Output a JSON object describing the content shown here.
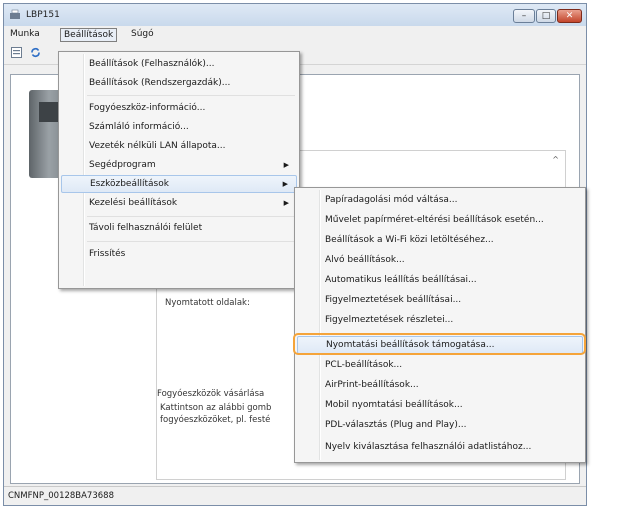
{
  "window": {
    "title": "LBP151",
    "buttons": {
      "minimize": "–",
      "maximize": "□",
      "close": "✕"
    }
  },
  "menubar": {
    "items": [
      "Munka",
      "Beállítások",
      "Súgó"
    ],
    "active": "Beállítások"
  },
  "main_menu": {
    "items": [
      {
        "label": "Beállítások (Felhasználók)..."
      },
      {
        "label": "Beállítások (Rendszergazdák)..."
      },
      {
        "label": "Fogyóeszköz-információ..."
      },
      {
        "label": "Számláló információ..."
      },
      {
        "label": "Vezeték nélküli LAN állapota..."
      },
      {
        "label": "Segédprogram",
        "submenu": true
      },
      {
        "label": "Eszközbeállítások",
        "submenu": true,
        "highlighted": true
      },
      {
        "label": "Kezelési beállítások",
        "submenu": true
      },
      {
        "label": "Távoli felhasználói felület"
      },
      {
        "label": "Frissítés"
      }
    ]
  },
  "sub_menu": {
    "items": [
      {
        "label": "Papíradagolási mód váltása..."
      },
      {
        "label": "Művelet papírméret-eltérési beállítások esetén..."
      },
      {
        "label": "Beállítások a Wi-Fi közi letöltéséhez..."
      },
      {
        "label": "Alvó beállítások..."
      },
      {
        "label": "Automatikus leállítás beállításai..."
      },
      {
        "label": "Figyelmeztetések beállításai..."
      },
      {
        "label": "Figyelmeztetések részletei..."
      },
      {
        "label": "Nyomtatási beállítások támogatása...",
        "highlighted": true
      },
      {
        "label": "PCL-beállítások..."
      },
      {
        "label": "AirPrint-beállítások..."
      },
      {
        "label": "Mobil nyomtatási beállítások..."
      },
      {
        "label": "PDL-választás (Plug and Play)..."
      },
      {
        "label": "Nyelv kiválasztása felhasználói adatlistához..."
      }
    ]
  },
  "content": {
    "printed_pages_label": "Nyomtatott oldalak:",
    "consumables_label": "Fogyóeszközök vásárlása",
    "consumables_text_1": "Kattintson az alábbi gomb",
    "consumables_text_2": "fogyóeszközöket, pl. festé"
  },
  "statusbar": {
    "text": "CNMFNP_00128BA73688"
  },
  "colors": {
    "highlight_border": "#f5a43a",
    "close_button": "#c3452b"
  },
  "icons": [
    "app-icon",
    "printer-list-icon",
    "refresh-icon",
    "submenu-arrow-icon"
  ]
}
